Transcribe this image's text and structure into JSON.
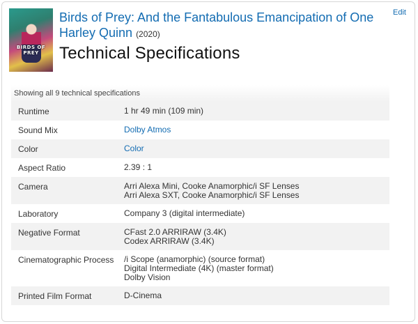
{
  "header": {
    "edit_label": "Edit",
    "title": "Birds of Prey: And the Fantabulous Emancipation of One Harley Quinn",
    "year": "(2020)",
    "section_title": "Technical Specifications",
    "poster_text": "BIRDS OF PREY"
  },
  "table": {
    "summary": "Showing all 9 technical specifications",
    "rows": [
      {
        "label": "Runtime",
        "values": [
          "1 hr 49 min (109 min)"
        ],
        "link": false
      },
      {
        "label": "Sound Mix",
        "values": [
          "Dolby Atmos"
        ],
        "link": true
      },
      {
        "label": "Color",
        "values": [
          "Color"
        ],
        "link": true
      },
      {
        "label": "Aspect Ratio",
        "values": [
          "2.39 : 1"
        ],
        "link": false
      },
      {
        "label": "Camera",
        "values": [
          "Arri Alexa Mini, Cooke Anamorphic/i SF Lenses",
          "Arri Alexa SXT, Cooke Anamorphic/i SF Lenses"
        ],
        "link": false
      },
      {
        "label": "Laboratory",
        "values": [
          "Company 3 (digital intermediate)"
        ],
        "link": false
      },
      {
        "label": "Negative Format",
        "values": [
          "CFast 2.0 ARRIRAW (3.4K)",
          "Codex ARRIRAW (3.4K)"
        ],
        "link": false
      },
      {
        "label": "Cinematographic Process",
        "values": [
          "/i Scope (anamorphic) (source format)",
          "Digital Intermediate (4K) (master format)",
          "Dolby Vision"
        ],
        "link": false
      },
      {
        "label": "Printed Film Format",
        "values": [
          "D-Cinema"
        ],
        "link": false
      }
    ]
  },
  "colors": {
    "link": "#136cb2",
    "row_alt": "#f2f2f2"
  }
}
